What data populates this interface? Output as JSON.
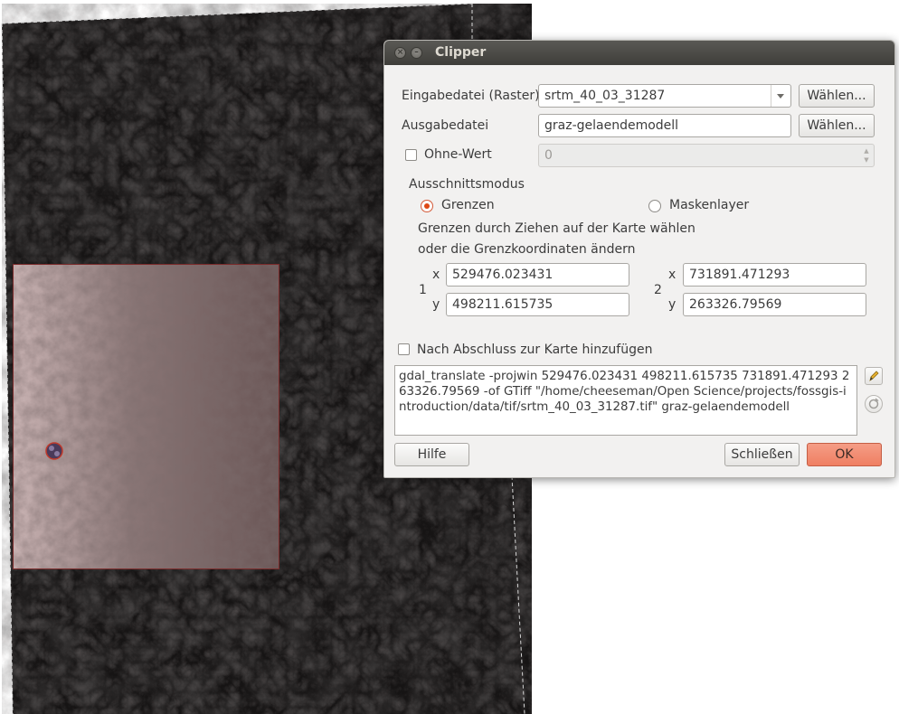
{
  "dialog": {
    "title": "Clipper",
    "input_label": "Eingabedatei (Raster)",
    "input_value": "srtm_40_03_31287",
    "input_browse": "Wählen...",
    "output_label": "Ausgabedatei",
    "output_value": "graz-gelaendemodell",
    "output_browse": "Wählen...",
    "nodata_label": "Ohne-Wert",
    "nodata_value": "0",
    "clip_mode_label": "Ausschnittsmodus",
    "mode_extent": "Grenzen",
    "mode_mask": "Maskenlayer",
    "hint_line1": "Grenzen durch Ziehen auf der Karte wählen",
    "hint_line2": "oder die Grenzkoordinaten ändern",
    "point1_label": "1",
    "point2_label": "2",
    "x_label": "x",
    "y_label": "y",
    "p1_x": "529476.023431",
    "p1_y": "498211.615735",
    "p2_x": "731891.471293",
    "p2_y": "263326.79569",
    "add_to_map_label": "Nach Abschluss zur Karte hinzufügen",
    "command": "gdal_translate -projwin 529476.023431 498211.615735 731891.471293 263326.79569 -of GTiff \"/home/cheeseman/Open Science/projects/fossgis-introduction/data/tif/srtm_40_03_31287.tif\" graz-gelaendemodell",
    "help_button": "Hilfe",
    "close_button": "Schließen",
    "ok_button": "OK"
  },
  "icons": {
    "close": "close-icon",
    "minimize": "minimize-icon",
    "edit": "pencil-icon",
    "reset": "reset-icon"
  },
  "colors": {
    "accent": "#dd4814",
    "ok_button": "#ef7f62",
    "titlebar": "#3f3e3a",
    "selection_rect": "#b8a0a0"
  }
}
